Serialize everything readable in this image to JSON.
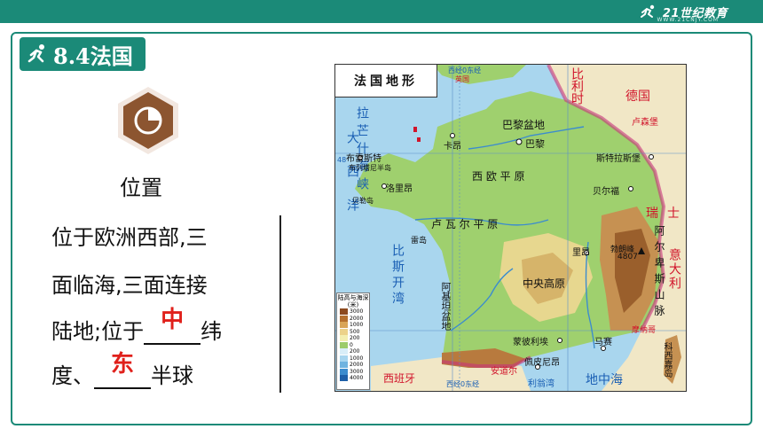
{
  "brand": {
    "name": "21世纪教育",
    "sub": "WWW.21CNJY.COM"
  },
  "lesson": {
    "title": "8.4法国"
  },
  "section": {
    "heading": "位置"
  },
  "content": {
    "line1": "位于欧洲西部,三",
    "line2": "面临海,三面连接",
    "line3_pre": "陆地;位于",
    "line3_post": "纬",
    "line4_pre": "度、",
    "line4_post": "半球",
    "answer1": "中",
    "answer2": "东"
  },
  "map": {
    "title": "法国地形",
    "labels": {
      "west0_top": "西经0东经",
      "west0_bottom": "西经0东经",
      "uk": "英国",
      "belgium": "比利时",
      "germany": "德国",
      "luxembourg": "卢森堡",
      "lat48": "48",
      "channel": "拉芒什海峡",
      "atlantic": "大西洋",
      "biscay": "比斯开湾",
      "paris_basin": "巴黎盆地",
      "paris": "巴黎",
      "rouen": "卡昂",
      "brest": "布雷斯特",
      "brittany": "布列塔尼半岛",
      "lorient": "洛里昂",
      "belle_ile": "贝勒岛",
      "west_plain": "西 欧 平 原",
      "loire_plain": "卢 瓦 尔 平 原",
      "strasbourg": "斯特拉斯堡",
      "belfort": "贝尔福",
      "switzerland": "瑞士",
      "alps": "阿尔卑斯山脉",
      "italy": "意大利",
      "mont_blanc": "勃朗峰",
      "mont_blanc_h": "4807",
      "lyon": "里昂",
      "central_massif": "中央高原",
      "rhe": "雷岛",
      "aquitaine": "阿基坦盆地",
      "montpellier": "蒙彼利埃",
      "marseille": "马赛",
      "perpignan": "佩皮尼昂",
      "spain": "西班牙",
      "andorra": "安道尔",
      "monaco": "摩纳哥",
      "corsica": "科西嘉岛",
      "mediterranean": "地中海",
      "gulf_lion": "利翁湾",
      "legend_title": "陆高与海深(米)"
    },
    "legend": {
      "values": [
        "3000",
        "2000",
        "1000",
        "500",
        "200",
        "0",
        "200",
        "1000",
        "2000",
        "3000",
        "4000"
      ],
      "colors": [
        "#8c4a1f",
        "#b5702e",
        "#d9a557",
        "#ecd28a",
        "#f3eeb0",
        "#9ccc6a",
        "#d9eef8",
        "#a7d5ef",
        "#6fb3e0",
        "#3c8cce",
        "#1e5fa8"
      ]
    },
    "colors": {
      "sea": "#a9d6ee",
      "lowland": "#9fd06e",
      "hill": "#e7d78f",
      "mountain": "#b87a3e",
      "neighbor": "#f1e7c6",
      "border": "#c8327a"
    }
  }
}
